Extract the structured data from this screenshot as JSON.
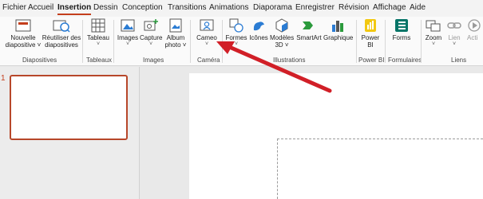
{
  "tabs": [
    {
      "label": "Fichier"
    },
    {
      "label": "Accueil"
    },
    {
      "label": "Insertion"
    },
    {
      "label": "Dessin"
    },
    {
      "label": "Conception"
    },
    {
      "label": "Transitions"
    },
    {
      "label": "Animations"
    },
    {
      "label": "Diaporama"
    },
    {
      "label": "Enregistrer"
    },
    {
      "label": "Révision"
    },
    {
      "label": "Affichage"
    },
    {
      "label": "Aide"
    }
  ],
  "active_tab": "Insertion",
  "ribbon": {
    "nouvelle": {
      "line1": "Nouvelle",
      "line2": "diapositive ˅"
    },
    "reutiliser": {
      "line1": "Réutiliser des",
      "line2": "diapositives"
    },
    "tableau": {
      "line1": "Tableau",
      "caret": "˅"
    },
    "images": {
      "line1": "Images",
      "caret": "˅"
    },
    "capture": {
      "line1": "Capture",
      "caret": "˅"
    },
    "album": {
      "line1": "Album",
      "line2": "photo ˅"
    },
    "cameo": {
      "line1": "Cameo",
      "caret": "˅"
    },
    "formes": {
      "line1": "Formes",
      "caret": "˅"
    },
    "icones": {
      "line1": "Icônes"
    },
    "modeles3d": {
      "line1": "Modèles",
      "line2": "3D ˅"
    },
    "smartart": {
      "line1": "SmartArt"
    },
    "graphique": {
      "line1": "Graphique"
    },
    "powerbi": {
      "line1": "Power",
      "line2": "BI"
    },
    "forms": {
      "line1": "Forms"
    },
    "zoom": {
      "line1": "Zoom",
      "caret": "˅"
    },
    "lien": {
      "line1": "Lien",
      "caret": "˅"
    },
    "action": {
      "line1": "Acti"
    },
    "groups": {
      "diapositives": "Diapositives",
      "tableaux": "Tableaux",
      "images": "Images",
      "camera": "Caméra",
      "illustrations": "Illustrations",
      "powerbi": "Power BI",
      "formulaires": "Formulaires",
      "liens": "Liens"
    }
  },
  "slides": {
    "number": "1"
  },
  "colors": {
    "accent": "#c43e1c",
    "arrow": "#d11f27"
  }
}
